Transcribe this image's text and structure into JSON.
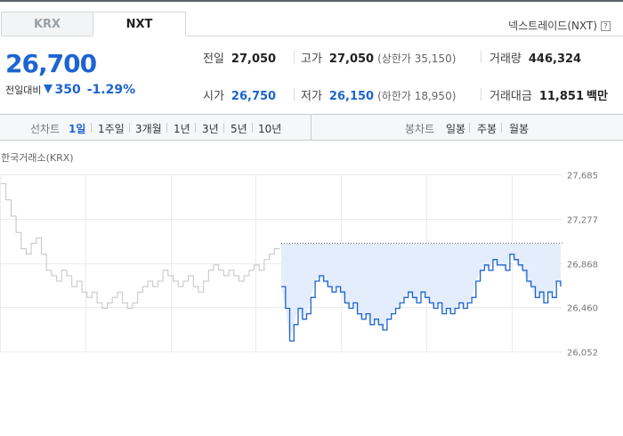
{
  "tabs": [
    {
      "label": "KRX",
      "active": false
    },
    {
      "label": "NXT",
      "active": true
    }
  ],
  "exchange_name": "넥스트레이드(NXT)",
  "help_icon": "question-mark-icon",
  "price": {
    "current": "26,700",
    "change_label": "전일대비",
    "change_direction_icon": "down-triangle-icon",
    "change_value": "350",
    "change_pct": "-1.29%"
  },
  "stats": {
    "prev_close": {
      "label": "전일",
      "value": "27,050"
    },
    "high": {
      "label": "고가",
      "value": "27,050",
      "sub": "(상한가 35,150)"
    },
    "volume": {
      "label": "거래량",
      "value": "446,324"
    },
    "open": {
      "label": "시가",
      "value": "26,750"
    },
    "low": {
      "label": "저가",
      "value": "26,150",
      "sub": "(하한가 18,950)"
    },
    "trade_value": {
      "label": "거래대금",
      "value": "11,851",
      "unit": "백만"
    }
  },
  "periods": {
    "label": "선차트",
    "items": [
      "1일",
      "1주일",
      "3개월",
      "1년",
      "3년",
      "5년",
      "10년"
    ],
    "active": "1일"
  },
  "candles": {
    "label": "봉차트",
    "items": [
      "일봉",
      "주봉",
      "월봉"
    ]
  },
  "colors": {
    "down": "#1d64d0",
    "krx_line": "#c4c4c4",
    "fill": "#e4edfb"
  },
  "chart_data": {
    "type": "line",
    "market_label": "한국거래소(KRX)",
    "y_ticks": [
      "27,685",
      "27,277",
      "26,868",
      "26,460",
      "26,052"
    ],
    "ylim": [
      26052,
      27685
    ],
    "reference_value": 27050,
    "grid": true,
    "series": [
      {
        "values": [
          27600,
          27450,
          27300,
          27150,
          27000,
          26950,
          27050,
          27100,
          26950,
          26800,
          26750,
          26700,
          26800,
          26750,
          26650,
          26700,
          26600,
          26550,
          26600,
          26500,
          26450,
          26500,
          26550,
          26600,
          26500,
          26450,
          26500,
          26600,
          26650,
          26700,
          26650,
          26700,
          26800,
          26750,
          26700,
          26650,
          26700,
          26750,
          26650,
          26600,
          26700,
          26800,
          26850,
          26800,
          26750,
          26800,
          26750,
          26700,
          26750,
          26800,
          26850,
          26800,
          26900,
          26950,
          27000,
          27000
        ]
      },
      {
        "values": [
          26650,
          26450,
          26150,
          26300,
          26450,
          26350,
          26400,
          26550,
          26700,
          26750,
          26700,
          26650,
          26600,
          26650,
          26600,
          26500,
          26450,
          26500,
          26400,
          26350,
          26400,
          26300,
          26350,
          26300,
          26250,
          26350,
          26400,
          26450,
          26500,
          26550,
          26600,
          26550,
          26500,
          26600,
          26550,
          26500,
          26450,
          26500,
          26400,
          26450,
          26400,
          26450,
          26500,
          26450,
          26500,
          26550,
          26700,
          26800,
          26850,
          26800,
          26900,
          26850,
          26850,
          26800,
          26950,
          26900,
          26850,
          26800,
          26700,
          26650,
          26550,
          26600,
          26500,
          26600,
          26550,
          26700,
          26650
        ]
      }
    ]
  }
}
